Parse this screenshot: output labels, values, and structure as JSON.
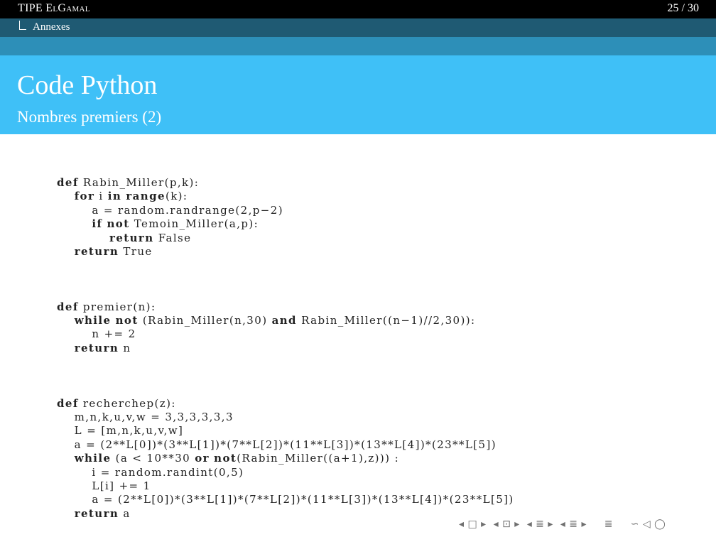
{
  "header": {
    "presentation_title": "TIPE ElGamal",
    "page_counter": "25 / 30",
    "section": "Annexes"
  },
  "frame": {
    "title": "Code Python",
    "subtitle": "Nombres premiers (2)"
  },
  "code": {
    "lines": [
      [
        [
          "k",
          "def"
        ],
        [
          "t",
          " Rabin_Miller(p,k):"
        ]
      ],
      [
        [
          "t",
          "    "
        ],
        [
          "k",
          "for"
        ],
        [
          "t",
          " i "
        ],
        [
          "k",
          "in"
        ],
        [
          "t",
          " "
        ],
        [
          "k",
          "range"
        ],
        [
          "t",
          "(k):"
        ]
      ],
      [
        [
          "t",
          "        a = random.randrange(2,p−2)"
        ]
      ],
      [
        [
          "t",
          "        "
        ],
        [
          "k",
          "if"
        ],
        [
          "t",
          " "
        ],
        [
          "k",
          "not"
        ],
        [
          "t",
          " Temoin_Miller(a,p):"
        ]
      ],
      [
        [
          "t",
          "            "
        ],
        [
          "k",
          "return"
        ],
        [
          "t",
          " False"
        ]
      ],
      [
        [
          "t",
          "    "
        ],
        [
          "k",
          "return"
        ],
        [
          "t",
          " True"
        ]
      ],
      [
        [
          "t",
          ""
        ]
      ],
      [
        [
          "t",
          ""
        ]
      ],
      [
        [
          "t",
          ""
        ]
      ],
      [
        [
          "k",
          "def"
        ],
        [
          "t",
          " premier(n):"
        ]
      ],
      [
        [
          "t",
          "    "
        ],
        [
          "k",
          "while"
        ],
        [
          "t",
          " "
        ],
        [
          "k",
          "not"
        ],
        [
          "t",
          " (Rabin_Miller(n,30) "
        ],
        [
          "k",
          "and"
        ],
        [
          "t",
          " Rabin_Miller((n−1)//2,30)):"
        ]
      ],
      [
        [
          "t",
          "        n += 2"
        ]
      ],
      [
        [
          "t",
          "    "
        ],
        [
          "k",
          "return"
        ],
        [
          "t",
          " n"
        ]
      ],
      [
        [
          "t",
          ""
        ]
      ],
      [
        [
          "t",
          ""
        ]
      ],
      [
        [
          "t",
          ""
        ]
      ],
      [
        [
          "k",
          "def"
        ],
        [
          "t",
          " recherchep(z):"
        ]
      ],
      [
        [
          "t",
          "    m,n,k,u,v,w = 3,3,3,3,3,3"
        ]
      ],
      [
        [
          "t",
          "    L = [m,n,k,u,v,w]"
        ]
      ],
      [
        [
          "t",
          "    a = (2**L[0])*(3**L[1])*(7**L[2])*(11**L[3])*(13**L[4])*(23**L[5])"
        ]
      ],
      [
        [
          "t",
          "    "
        ],
        [
          "k",
          "while"
        ],
        [
          "t",
          " (a < 10**30 "
        ],
        [
          "k",
          "or"
        ],
        [
          "t",
          " "
        ],
        [
          "k",
          "not"
        ],
        [
          "t",
          "(Rabin_Miller((a+1),z))) :"
        ]
      ],
      [
        [
          "t",
          "        i = random.randint(0,5)"
        ]
      ],
      [
        [
          "t",
          "        L[i] += 1"
        ]
      ],
      [
        [
          "t",
          "        a = (2**L[0])*(3**L[1])*(7**L[2])*(11**L[3])*(13**L[4])*(23**L[5])"
        ]
      ],
      [
        [
          "t",
          "    "
        ],
        [
          "k",
          "return"
        ],
        [
          "t",
          " a"
        ]
      ]
    ]
  },
  "nav": {
    "first_prev": "◂ □ ▸",
    "frame": "◂ ⊡ ▸",
    "subsection": "◂ ≣ ▸",
    "section": "◂ ≣ ▸",
    "align": "≣",
    "search": "∽ ◁ ◯"
  }
}
